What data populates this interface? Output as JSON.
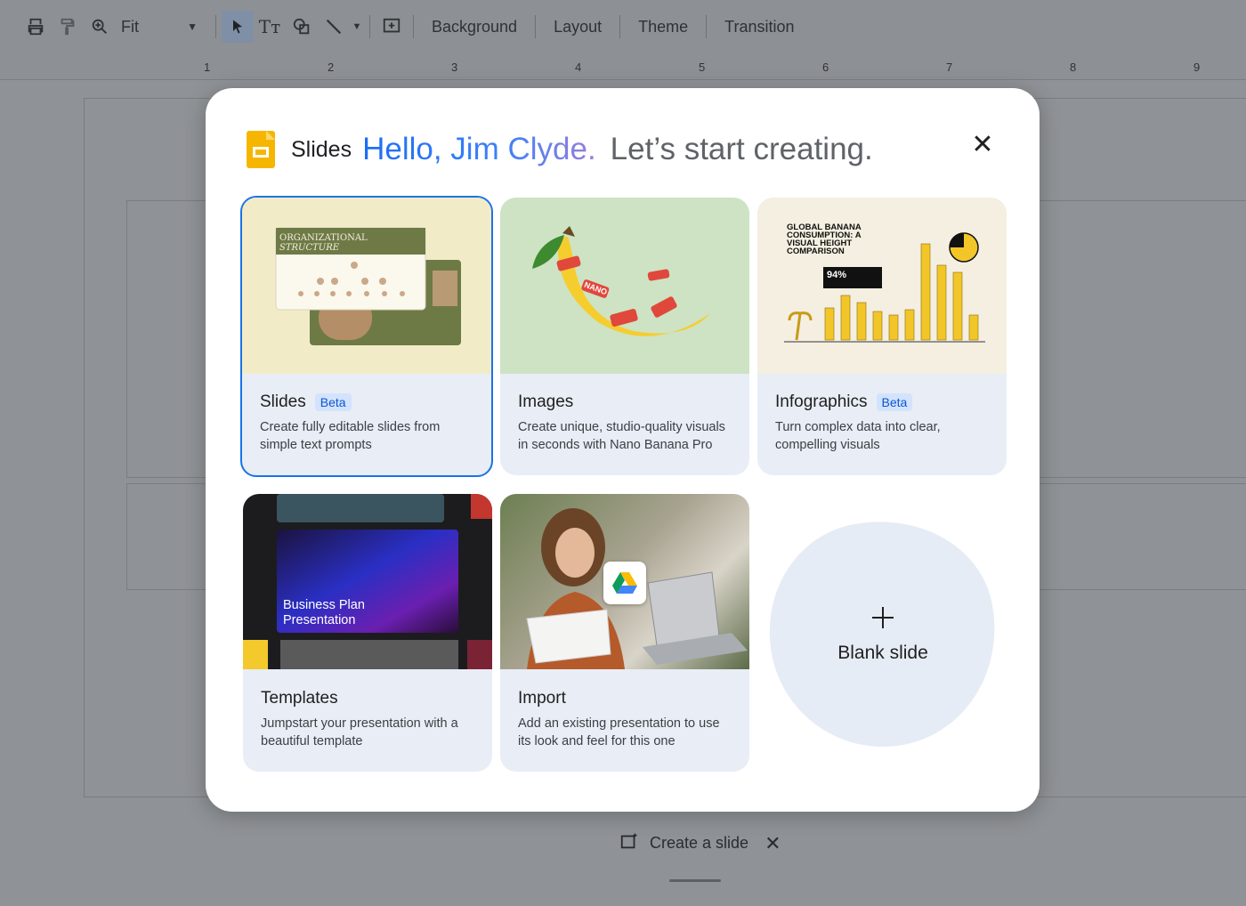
{
  "toolbar": {
    "zoom_label": "Fit",
    "menus": [
      "Background",
      "Layout",
      "Theme",
      "Transition"
    ]
  },
  "ruler": {
    "marks": [
      "1",
      "2",
      "3",
      "4",
      "5",
      "6",
      "7",
      "8",
      "9"
    ]
  },
  "bottom_bar": {
    "create_slide_label": "Create a slide"
  },
  "dialog": {
    "app_name": "Slides",
    "greeting": "Hello, Jim Clyde.",
    "subgreeting": "Let’s start creating.",
    "cards": [
      {
        "title": "Slides",
        "badge": "Beta",
        "description": "Create fully editable slides from simple text prompts"
      },
      {
        "title": "Images",
        "badge": "",
        "description": "Create unique, studio-quality visuals in seconds with Nano Banana Pro"
      },
      {
        "title": "Infographics",
        "badge": "Beta",
        "description": "Turn complex data into clear, compelling visuals"
      },
      {
        "title": "Templates",
        "badge": "",
        "description": "Jumpstart your presentation with a beautiful template"
      },
      {
        "title": "Import",
        "badge": "",
        "description": "Add an existing presentation to use its look and feel for this one"
      }
    ],
    "blank_slide_label": "Blank slide",
    "art_text": {
      "org_title_1": "ORGANIZATIONAL",
      "org_title_2": "STRUCTURE",
      "banana_sticker": "NANO",
      "info_title": "GLOBAL BANANA CONSUMPTION: A VISUAL HEIGHT COMPARISON",
      "info_percent": "94%",
      "tpl_title_1": "Business Plan",
      "tpl_title_2": "Presentation"
    }
  },
  "colors": {
    "accent": "#1a73e8",
    "logo": "#f6b600",
    "card_bg": "#e8edf6"
  }
}
